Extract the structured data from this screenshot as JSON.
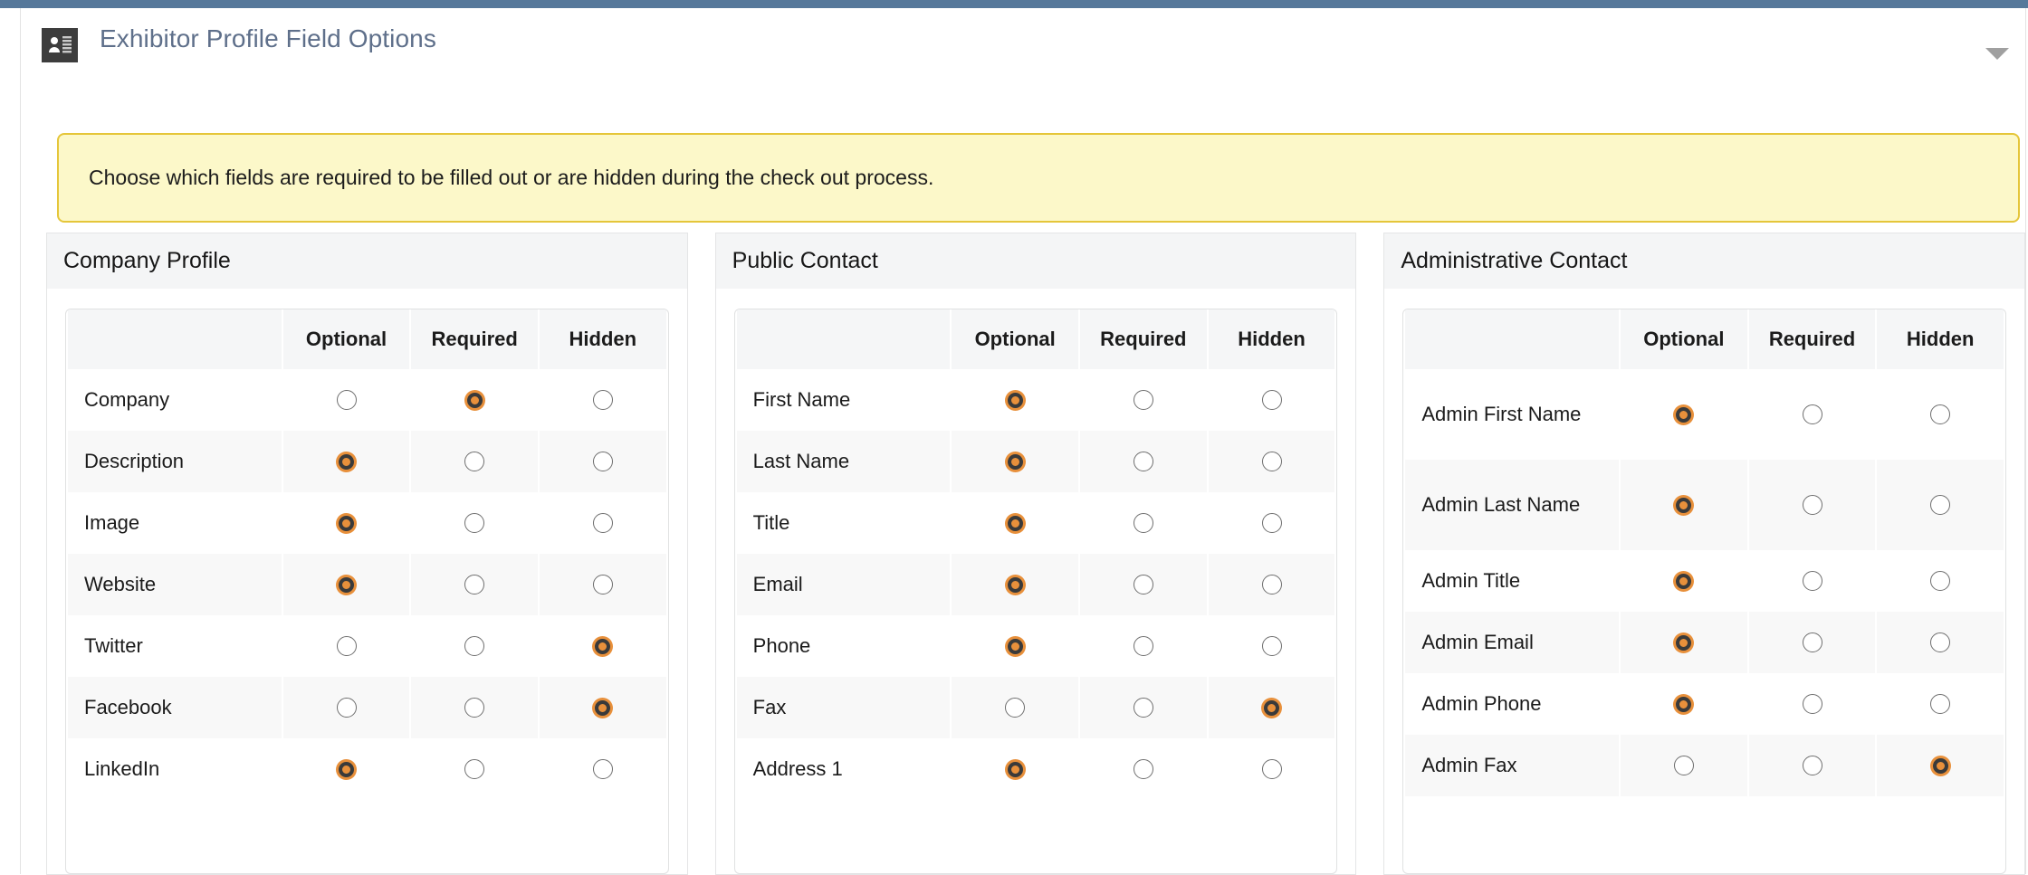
{
  "topbar": {
    "color": "#56789a"
  },
  "header": {
    "title": "Exhibitor Profile Field Options",
    "icon": "contact-card-icon",
    "collapse_icon": "chevron-down-icon",
    "title_color": "#5e6f8a"
  },
  "notice": {
    "text": "Choose which fields are required to be filled out or are hidden during the check out process.",
    "background": "#fcf8c9",
    "border_color": "#e5c63a"
  },
  "colors": {
    "selected_radio": "#e8903b",
    "radio_ring": "#3a3a3a",
    "unselected_radio_border": "#6e6e6e",
    "panel_header_bg": "#f4f5f6",
    "row_stripe": "#f8f8f8"
  },
  "columns": [
    "Optional",
    "Required",
    "Hidden"
  ],
  "panels": [
    {
      "title": "Company Profile",
      "columns": [
        "Optional",
        "Required",
        "Hidden"
      ],
      "rows": [
        {
          "label": "Company",
          "selected": "Required",
          "tall": false
        },
        {
          "label": "Description",
          "selected": "Optional",
          "tall": false
        },
        {
          "label": "Image",
          "selected": "Optional",
          "tall": false
        },
        {
          "label": "Website",
          "selected": "Optional",
          "tall": false
        },
        {
          "label": "Twitter",
          "selected": "Hidden",
          "tall": false
        },
        {
          "label": "Facebook",
          "selected": "Hidden",
          "tall": false
        },
        {
          "label": "LinkedIn",
          "selected": "Optional",
          "tall": false
        }
      ]
    },
    {
      "title": "Public Contact",
      "columns": [
        "Optional",
        "Required",
        "Hidden"
      ],
      "rows": [
        {
          "label": "First Name",
          "selected": "Optional",
          "tall": false
        },
        {
          "label": "Last Name",
          "selected": "Optional",
          "tall": false
        },
        {
          "label": "Title",
          "selected": "Optional",
          "tall": false
        },
        {
          "label": "Email",
          "selected": "Optional",
          "tall": false
        },
        {
          "label": "Phone",
          "selected": "Optional",
          "tall": false
        },
        {
          "label": "Fax",
          "selected": "Hidden",
          "tall": false
        },
        {
          "label": "Address 1",
          "selected": "Optional",
          "tall": false
        }
      ]
    },
    {
      "title": "Administrative Contact",
      "columns": [
        "Optional",
        "Required",
        "Hidden"
      ],
      "rows": [
        {
          "label": "Admin First Name",
          "selected": "Optional",
          "tall": true
        },
        {
          "label": "Admin Last Name",
          "selected": "Optional",
          "tall": true
        },
        {
          "label": "Admin Title",
          "selected": "Optional",
          "tall": false
        },
        {
          "label": "Admin Email",
          "selected": "Optional",
          "tall": false
        },
        {
          "label": "Admin Phone",
          "selected": "Optional",
          "tall": false
        },
        {
          "label": "Admin Fax",
          "selected": "Hidden",
          "tall": false
        }
      ]
    }
  ]
}
